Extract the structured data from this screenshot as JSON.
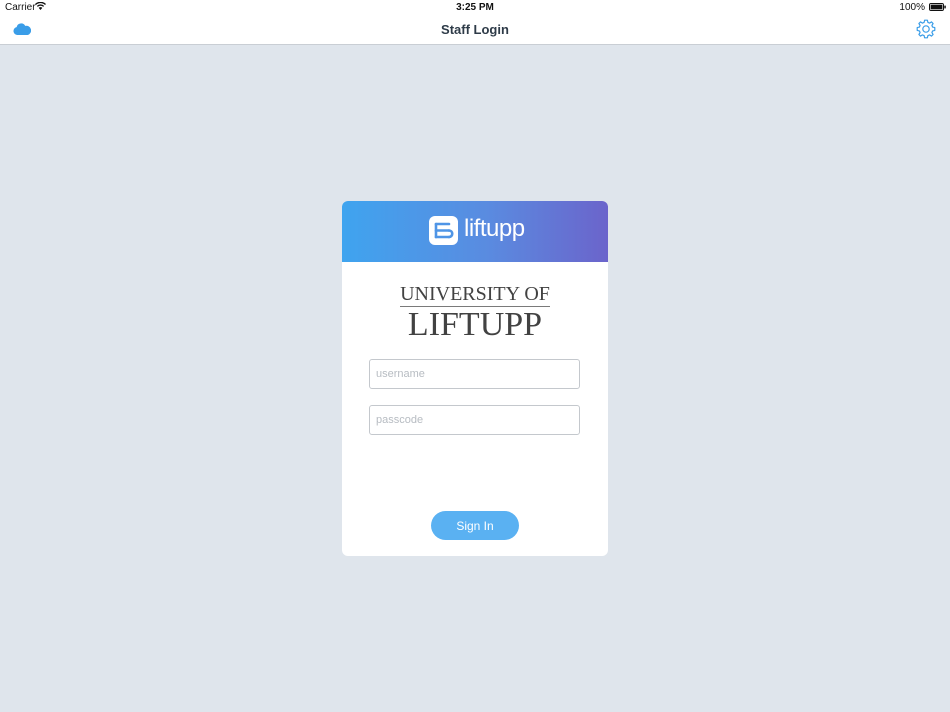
{
  "status_bar": {
    "carrier": "Carrier",
    "time": "3:25 PM",
    "battery": "100%"
  },
  "nav": {
    "title": "Staff Login",
    "left_icon": "cloud-icon",
    "right_icon": "gear-icon",
    "accent_color": "#3a9de8"
  },
  "card": {
    "brand_name": "liftupp",
    "university_line1": "UNIVERSITY OF",
    "university_line2": "LIFTUPP",
    "username_placeholder": "username",
    "passcode_placeholder": "passcode",
    "signin_label": "Sign In",
    "header_gradient": [
      "#3fa4ef",
      "#6b64cb"
    ],
    "button_color": "#5ab1f2"
  }
}
